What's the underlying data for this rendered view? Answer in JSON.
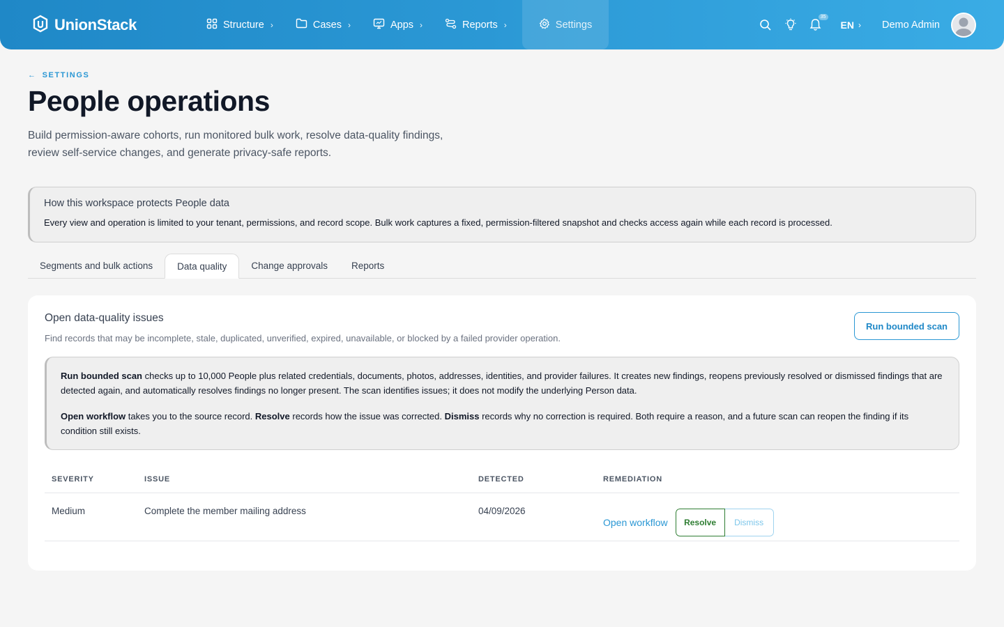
{
  "brand": {
    "name": "UnionStack",
    "logo_icon": "hexagon-logo-icon"
  },
  "nav": {
    "items": [
      {
        "label": "Structure",
        "icon": "grid-icon"
      },
      {
        "label": "Cases",
        "icon": "folder-icon"
      },
      {
        "label": "Apps",
        "icon": "monitor-icon"
      },
      {
        "label": "Reports",
        "icon": "route-icon"
      },
      {
        "label": "Settings",
        "icon": "gear-icon"
      }
    ],
    "chevron": "›"
  },
  "toolbar": {
    "notification_badge": "35",
    "language": "EN",
    "language_chevron": "›",
    "user_name": "Demo Admin"
  },
  "header": {
    "back_arrow": "←",
    "back_label": "SETTINGS",
    "title": "People operations",
    "subtitle": "Build permission-aware cohorts, run monitored bulk work, resolve data-quality findings, review self-service changes, and generate privacy-safe reports."
  },
  "notice": {
    "title": "How this workspace protects People data",
    "text": "Every view and operation is limited to your tenant, permissions, and record scope. Bulk work captures a fixed, permission-filtered snapshot and checks access again while each record is processed."
  },
  "tabs": [
    {
      "label": "Segments and bulk actions",
      "active": false
    },
    {
      "label": "Data quality",
      "active": true
    },
    {
      "label": "Change approvals",
      "active": false
    },
    {
      "label": "Reports",
      "active": false
    }
  ],
  "card": {
    "title": "Open data-quality issues",
    "subtitle": "Find records that may be incomplete, stale, duplicated, unverified, expired, unavailable, or blocked by a failed provider operation.",
    "scan_button": "Run bounded scan",
    "info": {
      "p1_bold": "Run bounded scan",
      "p1_text": " checks up to 10,000 People plus related credentials, documents, photos, addresses, identities, and provider failures. It creates new findings, reopens previously resolved or dismissed findings that are detected again, and automatically resolves findings no longer present. The scan identifies issues; it does not modify the underlying Person data.",
      "p2_b1": "Open workflow",
      "p2_t1": " takes you to the source record. ",
      "p2_b2": "Resolve",
      "p2_t2": " records how the issue was corrected. ",
      "p2_b3": "Dismiss",
      "p2_t3": " records why no correction is required. Both require a reason, and a future scan can reopen the finding if its condition still exists."
    },
    "table": {
      "headers": [
        "SEVERITY",
        "ISSUE",
        "DETECTED",
        "REMEDIATION"
      ],
      "rows": [
        {
          "severity": "Medium",
          "issue": "Complete the member mailing address",
          "detected": "04/09/2026",
          "workflow_link": "Open workflow",
          "resolve_label": "Resolve",
          "dismiss_label": "Dismiss"
        }
      ]
    }
  },
  "colors": {
    "accent": "#2a97d4",
    "resolve": "#2e7d32",
    "nav_start": "#1f88c7",
    "nav_end": "#3aace5"
  }
}
